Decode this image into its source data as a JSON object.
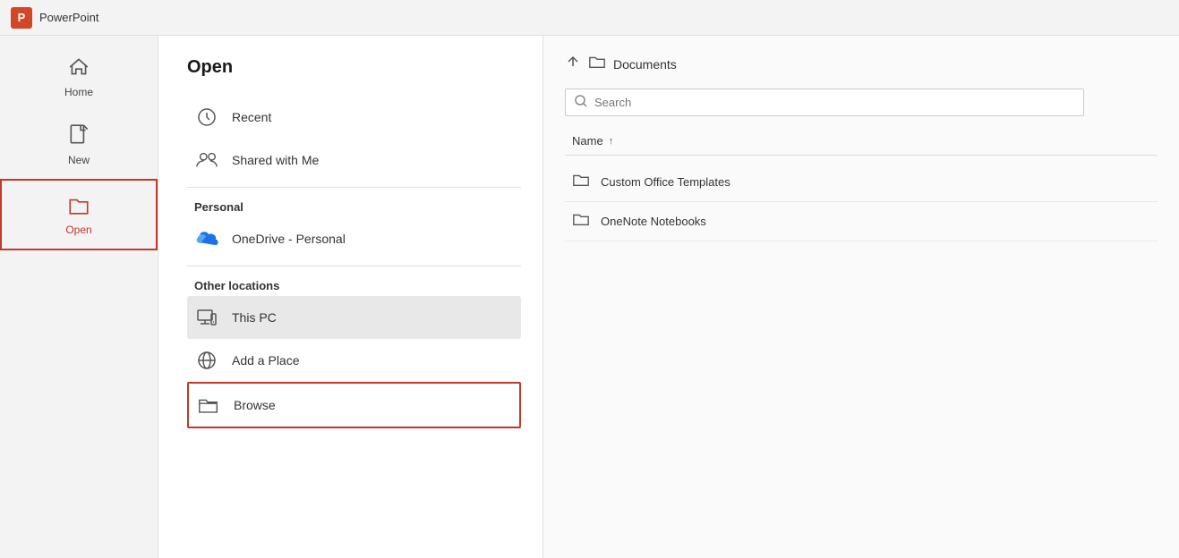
{
  "titleBar": {
    "logo": "P",
    "appName": "PowerPoint"
  },
  "sidebar": {
    "items": [
      {
        "id": "home",
        "label": "Home",
        "icon": "⌂",
        "active": false
      },
      {
        "id": "new",
        "label": "New",
        "icon": "🗋",
        "active": false
      },
      {
        "id": "open",
        "label": "Open",
        "icon": "🗁",
        "active": true
      }
    ]
  },
  "openPanel": {
    "title": "Open",
    "navItems": [
      {
        "id": "recent",
        "label": "Recent",
        "iconType": "clock"
      },
      {
        "id": "shared",
        "label": "Shared with Me",
        "iconType": "people"
      }
    ],
    "sections": [
      {
        "label": "Personal",
        "items": [
          {
            "id": "onedrive",
            "label": "OneDrive - Personal",
            "iconType": "cloud"
          }
        ]
      },
      {
        "label": "Other locations",
        "items": [
          {
            "id": "thispc",
            "label": "This PC",
            "iconType": "computer",
            "selected": true
          },
          {
            "id": "addplace",
            "label": "Add a Place",
            "iconType": "globe"
          },
          {
            "id": "browse",
            "label": "Browse",
            "iconType": "folder-open",
            "highlighted": true
          }
        ]
      }
    ]
  },
  "filePanel": {
    "breadcrumb": {
      "upLabel": "↑",
      "folderIcon": "🗁",
      "path": "Documents"
    },
    "search": {
      "placeholder": "Search",
      "iconLabel": "🔍"
    },
    "columns": [
      {
        "label": "Name",
        "sort": "↑"
      }
    ],
    "files": [
      {
        "id": "custom-templates",
        "name": "Custom Office Templates",
        "icon": "🗁"
      },
      {
        "id": "onenote-notebooks",
        "name": "OneNote Notebooks",
        "icon": "🗁"
      }
    ]
  }
}
